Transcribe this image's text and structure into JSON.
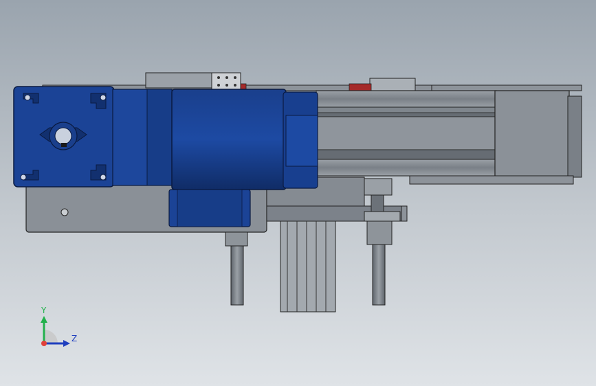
{
  "viewport": {
    "background_top": "#9aa4ae",
    "background_bottom": "#dfe3e7"
  },
  "model": {
    "motor_color": "#1a3f8c",
    "motor_dark": "#0f2a63",
    "frame_color": "#8a9097",
    "frame_dark": "#6a7077",
    "accent_red": "#a52a2a"
  },
  "triad": {
    "y_label": "Y",
    "z_label": "Z",
    "y_color": "#22b14c",
    "z_color": "#1f3fbf",
    "x_color": "#e0403a"
  }
}
